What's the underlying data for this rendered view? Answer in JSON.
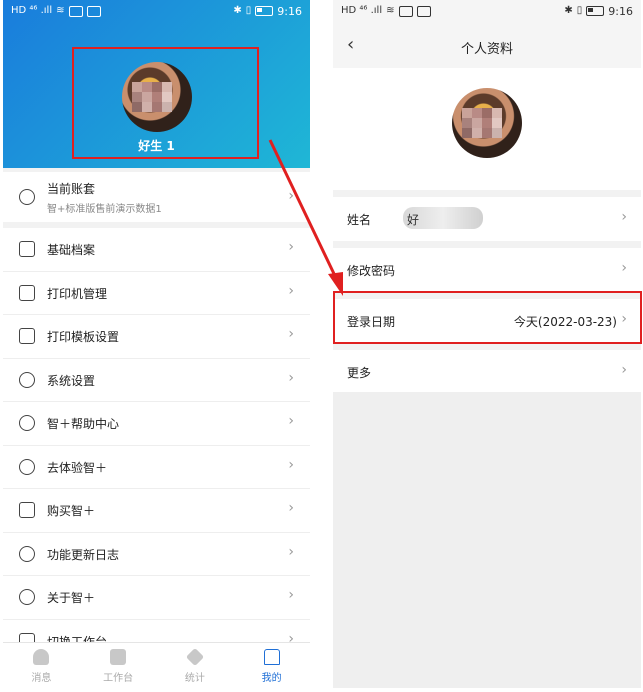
{
  "status_bar": {
    "signal": "HD ⁴⁶ .ıll",
    "time": "9:16"
  },
  "left": {
    "profile": {
      "name": "好生 1"
    },
    "account": {
      "title": "当前账套",
      "subtitle": "智+标准版售前演示数据1"
    },
    "menu": [
      {
        "label": "基础档案",
        "icon": "archive-icon"
      },
      {
        "label": "打印机管理",
        "icon": "printer-icon"
      },
      {
        "label": "打印模板设置",
        "icon": "template-icon"
      },
      {
        "label": "系统设置",
        "icon": "gear-icon"
      },
      {
        "label": "智＋帮助中心",
        "icon": "help-icon"
      },
      {
        "label": "去体验智＋",
        "icon": "experience-icon"
      },
      {
        "label": "购买智＋",
        "icon": "cart-icon"
      },
      {
        "label": "功能更新日志",
        "icon": "log-icon"
      },
      {
        "label": "关于智＋",
        "icon": "info-icon"
      },
      {
        "label": "切换工作台",
        "icon": "workspace-icon"
      }
    ],
    "tabs": [
      {
        "label": "消息",
        "icon": "message-icon",
        "active": false
      },
      {
        "label": "工作台",
        "icon": "workbench-icon",
        "active": false
      },
      {
        "label": "统计",
        "icon": "stats-icon",
        "active": false
      },
      {
        "label": "我的",
        "icon": "home-icon",
        "active": true
      }
    ]
  },
  "right": {
    "title": "个人资料",
    "rows": {
      "name_label": "姓名",
      "name_value": "好",
      "password_label": "修改密码",
      "login_label": "登录日期",
      "login_value": "今天(2022-03-23)",
      "more_label": "更多"
    }
  },
  "colors": {
    "accent": "#1f6fd6",
    "highlight": "#e02020",
    "header_start": "#1a7cdc",
    "header_end": "#1fb7d6"
  }
}
